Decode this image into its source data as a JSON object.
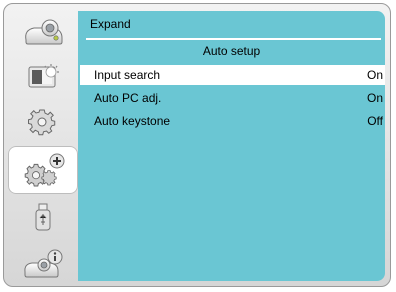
{
  "sidebar": {
    "items": [
      {
        "icon": "projector-icon"
      },
      {
        "icon": "picture-adjust-icon"
      },
      {
        "icon": "setting-gear-icon"
      },
      {
        "icon": "expand-gear-plus-icon",
        "selected": true
      },
      {
        "icon": "usb-memory-icon"
      },
      {
        "icon": "projector-info-icon"
      }
    ]
  },
  "panel": {
    "title": "Expand",
    "section": "Auto setup",
    "rows": [
      {
        "label": "Input search",
        "value": "On",
        "selected": true
      },
      {
        "label": "Auto PC adj.",
        "value": "On",
        "selected": false
      },
      {
        "label": "Auto keystone",
        "value": "Off",
        "selected": false
      }
    ]
  },
  "colors": {
    "panel_bg": "#6ac6d3",
    "highlight": "#ffffff"
  }
}
